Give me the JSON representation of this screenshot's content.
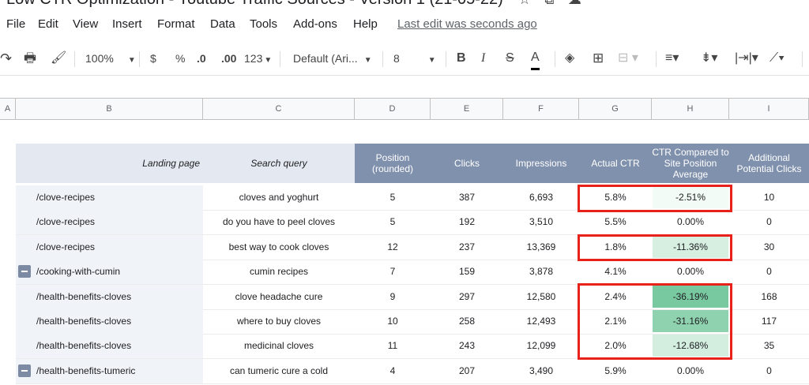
{
  "doc": {
    "title": "Low CTR Optimization - Youtube Traffic Sources - Version 1 (21-05-22)"
  },
  "title_icons": [
    "star-icon",
    "move-to-folder-icon",
    "cloud-status-icon"
  ],
  "menu": {
    "items": [
      "File",
      "Edit",
      "View",
      "Insert",
      "Format",
      "Data",
      "Tools",
      "Add-ons",
      "Help"
    ],
    "last_edit": "Last edit was seconds ago"
  },
  "toolbar": {
    "zoom": "100%",
    "currency": "$",
    "percent": "%",
    "dec_decrease": ".0",
    "dec_increase": ".00",
    "more_formats": "123",
    "font": "Default (Ari...",
    "font_size": "8",
    "bold": "B",
    "italic": "I",
    "strike": "S",
    "text_color": "A"
  },
  "columns": [
    "A",
    "B",
    "C",
    "D",
    "E",
    "F",
    "G",
    "H",
    "I"
  ],
  "table": {
    "headers": [
      "Landing page",
      "Search query",
      "Position (rounded)",
      "Clicks",
      "Impressions",
      "Actual CTR",
      "CTR Compared to Site Position Average",
      "Additional Potential Clicks"
    ],
    "rows": [
      [
        "/clove-recipes",
        "cloves and yoghurt",
        "5",
        "387",
        "6,693",
        "5.8%",
        "-2.51%",
        "10"
      ],
      [
        "/clove-recipes",
        "do you have to peel cloves",
        "5",
        "192",
        "3,510",
        "5.5%",
        "0.00%",
        "0"
      ],
      [
        "/clove-recipes",
        "best way to cook cloves",
        "12",
        "237",
        "13,369",
        "1.8%",
        "-11.36%",
        "30"
      ],
      [
        "/cooking-with-cumin",
        "cumin recipes",
        "7",
        "159",
        "3,878",
        "4.1%",
        "0.00%",
        "0"
      ],
      [
        "/health-benefits-cloves",
        "clove headache cure",
        "9",
        "297",
        "12,580",
        "2.4%",
        "-36.19%",
        "168"
      ],
      [
        "/health-benefits-cloves",
        "where to buy cloves",
        "10",
        "258",
        "12,493",
        "2.1%",
        "-31.16%",
        "117"
      ],
      [
        "/health-benefits-cloves",
        "medicinal cloves",
        "11",
        "243",
        "12,099",
        "2.0%",
        "-12.68%",
        "35"
      ],
      [
        "/health-benefits-tumeric",
        "can tumeric cure a cold",
        "4",
        "207",
        "3,490",
        "5.9%",
        "0.00%",
        "0"
      ]
    ]
  },
  "colors": {
    "header_dark": "#8091ad",
    "header_light": "#e4e9f1",
    "highlight_box": "#e8221b",
    "h_col_fills": [
      "#f3fbf6",
      "#ffffff",
      "#d6efe1",
      "#ffffff",
      "#79c9a0",
      "#8fd2b0",
      "#d3eedf",
      "#ffffff"
    ]
  }
}
